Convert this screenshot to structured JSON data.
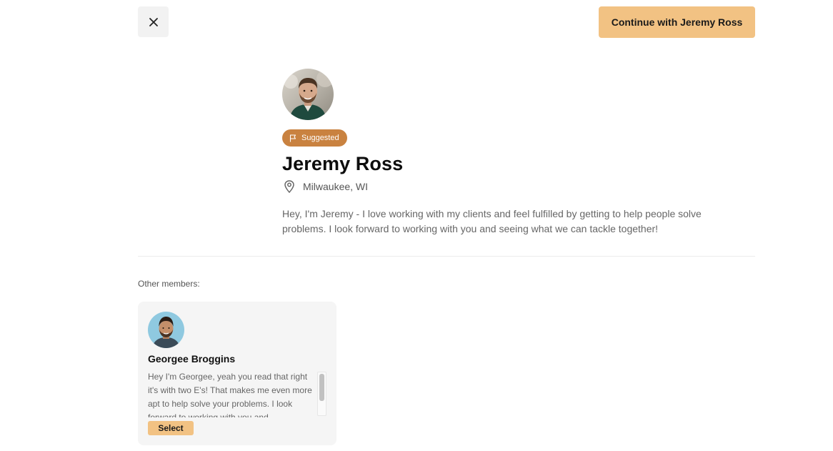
{
  "header": {
    "close_icon": "close-icon",
    "continue_label": "Continue with Jeremy Ross"
  },
  "profile": {
    "badge_icon": "flag-icon",
    "badge_label": "Suggested",
    "name": "Jeremy Ross",
    "location_icon": "map-pin-icon",
    "location": "Milwaukee, WI",
    "bio": "Hey, I'm Jeremy - I love working with my clients and feel fulfilled by getting to help people solve problems. I look forward to working with you and seeing what we can tackle together!"
  },
  "other_members": {
    "label": "Other members:",
    "members": [
      {
        "name": "Georgee Broggins",
        "bio": "Hey I'm Georgee, yeah you read that right it's with two E's! That makes me even more apt to help solve your problems. I look forward to working with you and",
        "select_label": "Select"
      }
    ]
  },
  "colors": {
    "accent": "#f2c283",
    "badge": "#c98240"
  }
}
